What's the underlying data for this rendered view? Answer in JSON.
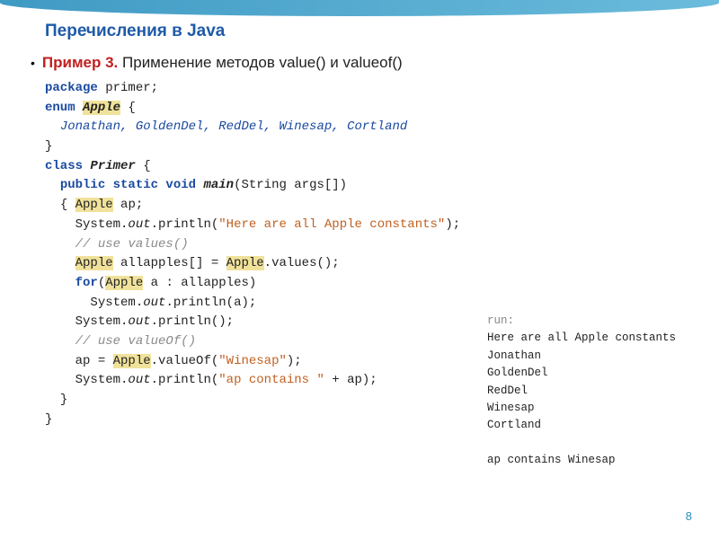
{
  "slide": {
    "title": "Перечисления в Java",
    "example_label": "Пример 3.",
    "example_desc": "Применение методов value() и valueof()",
    "page_number": "8"
  },
  "code": {
    "l1a": "package",
    "l1b": " primer;",
    "l2a": "enum",
    "l2b": "Apple",
    "l2c": " {",
    "l3": "Jonathan, GoldenDel, RedDel, Winesap, Cortland",
    "l4": "}",
    "l5a": "class",
    "l5b": "Primer",
    "l5c": " {",
    "l6a": "public static void",
    "l6b": "main",
    "l6c": "(String args[])",
    "l7a": "{ ",
    "l7b": "Apple",
    "l7c": " ap;",
    "l8a": "System.",
    "l8b": "out",
    "l8c": ".println(",
    "l8d": "\"Here are all Apple constants\"",
    "l8e": ");",
    "l9": "// use values()",
    "l10a": "Apple",
    "l10b": " allapples[] = ",
    "l10c": "Apple",
    "l10d": ".values();",
    "l11a": "for",
    "l11b": "(",
    "l11c": "Apple",
    "l11d": " a : allapples)",
    "l12a": "System.",
    "l12b": "out",
    "l12c": ".println(a);",
    "l13a": "System.",
    "l13b": "out",
    "l13c": ".println();",
    "l14": "// use valueOf()",
    "l15a": "ap = ",
    "l15b": "Apple",
    "l15c": ".valueOf(",
    "l15d": "\"Winesap\"",
    "l15e": ");",
    "l16a": "System.",
    "l16b": "out",
    "l16c": ".println(",
    "l16d": "\"ap contains \"",
    "l16e": " + ap);",
    "l17": "}",
    "l18": "}"
  },
  "output": {
    "run": "run:",
    "l1": "Here are all Apple constants",
    "l2": "Jonathan",
    "l3": "GoldenDel",
    "l4": "RedDel",
    "l5": "Winesap",
    "l6": "Cortland",
    "blank": "",
    "l7": "ap contains Winesap"
  }
}
